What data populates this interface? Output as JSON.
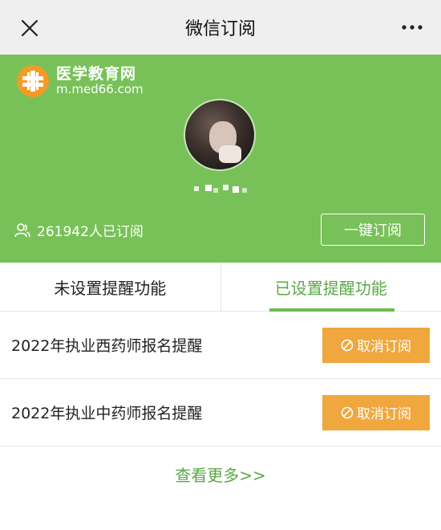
{
  "topbar": {
    "title": "微信订阅"
  },
  "header": {
    "logo_name": "医学教育网",
    "logo_url": "m.med66.com",
    "subscriber_count": "261942人已订阅",
    "one_key_subscribe": "一键订阅"
  },
  "tabs": [
    {
      "label": "未设置提醒功能",
      "active": false
    },
    {
      "label": "已设置提醒功能",
      "active": true
    }
  ],
  "list": {
    "items": [
      {
        "title": "2022年执业西药师报名提醒",
        "action": "取消订阅"
      },
      {
        "title": "2022年执业中药师报名提醒",
        "action": "取消订阅"
      }
    ]
  },
  "footer": {
    "more": "查看更多>>"
  },
  "colors": {
    "brand_green": "#78c158",
    "active_tab_text": "#5aa845",
    "cancel_orange": "#f0a73e",
    "topbar_bg": "#efefef"
  },
  "icons": {
    "close": "close-icon",
    "more": "more-dots-icon",
    "subscribers": "people-icon",
    "cancel": "ban-icon"
  }
}
